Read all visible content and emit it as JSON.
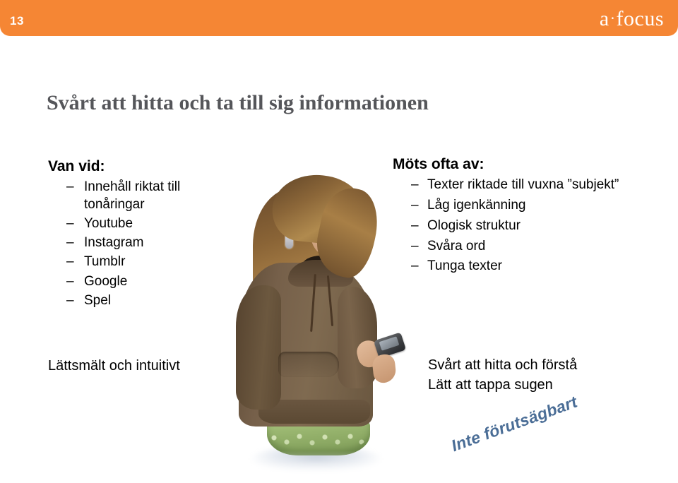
{
  "header": {
    "page_number": "13",
    "logo_text_a": "a",
    "logo_dot": "·",
    "logo_text_focus": "focus",
    "bar_color": "#F58634"
  },
  "title": "Svårt att hitta och ta till sig informationen",
  "left_column": {
    "heading": "Van vid:",
    "dash": "–",
    "items": [
      "Innehåll riktat till tonåringar",
      "Youtube",
      "Instagram",
      "Tumblr",
      "Google",
      "Spel"
    ],
    "caption": "Lättsmält och intuitivt"
  },
  "right_column": {
    "heading": "Möts ofta av:",
    "dash": "–",
    "items": [
      "Texter riktade till vuxna ”subjekt”",
      "Låg igenkänning",
      "Ologisk struktur",
      "Svåra ord",
      "Tunga texter"
    ],
    "captions": [
      "Svårt att hitta och förstå",
      "Lätt att tappa sugen"
    ]
  },
  "rotated_note": {
    "text": "Inte förutsägbart",
    "color": "#4a6d96"
  },
  "photo": {
    "alt": "Teenage girl in brown hoodie and green lace skirt looking down at a mobile phone"
  },
  "colors": {
    "accent_orange": "#F58634",
    "title_gray": "#55565a",
    "body_black": "#000000",
    "note_blue": "#4a6d96",
    "hoodie_brown": "#76604a",
    "skirt_green": "#93b06a",
    "hair_brown": "#8a6436"
  }
}
